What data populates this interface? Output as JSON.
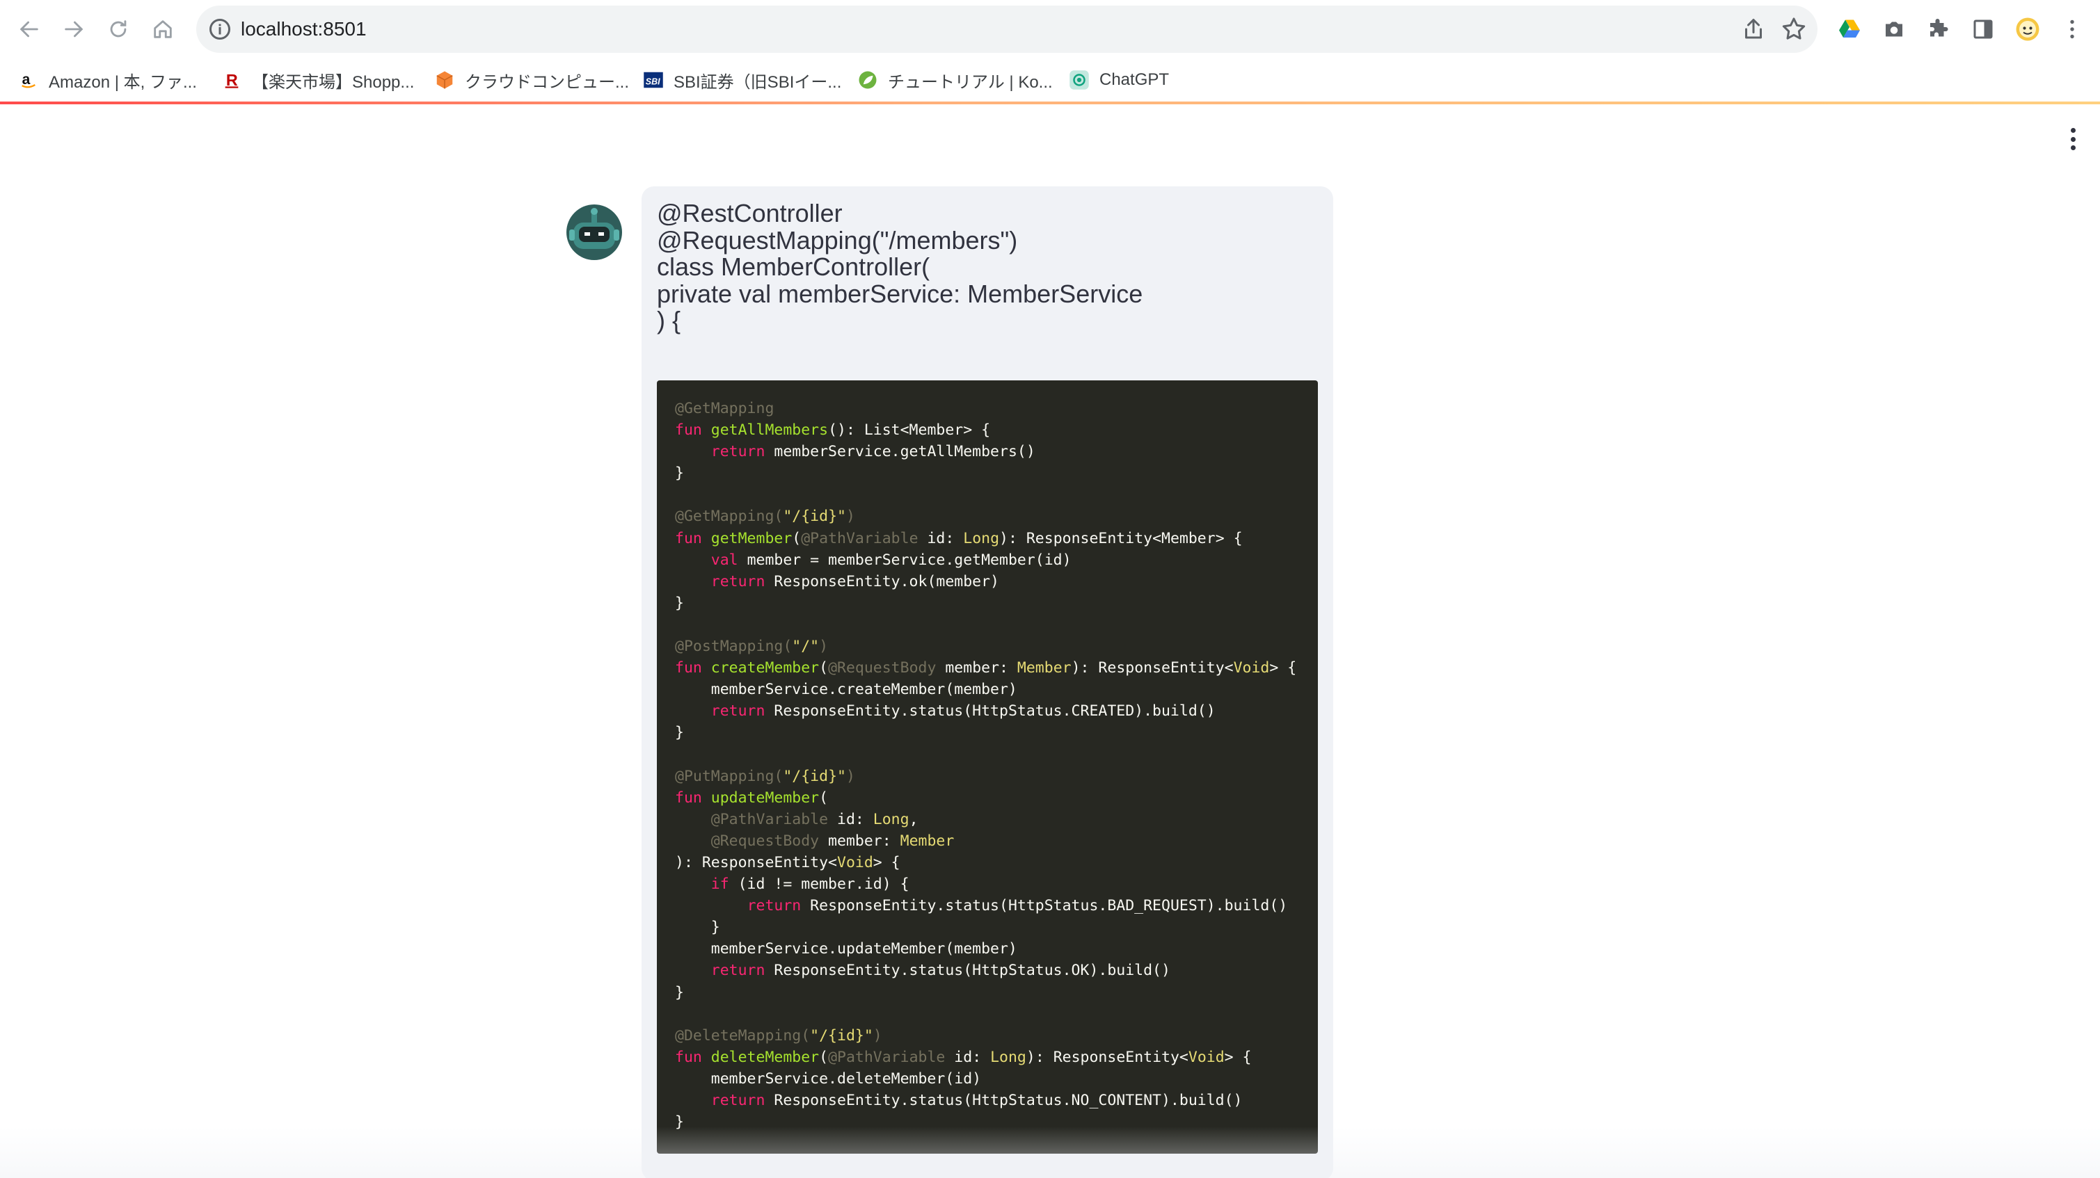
{
  "browser": {
    "url": "localhost:8501",
    "bookmarks": [
      {
        "label": "Amazon | 本, ファ...",
        "icon": "amazon-icon"
      },
      {
        "label": "【楽天市場】Shopp...",
        "icon": "rakuten-icon"
      },
      {
        "label": "クラウドコンピュー...",
        "icon": "cube-icon"
      },
      {
        "label": "SBI証券（旧SBIイー...",
        "icon": "sbi-icon"
      },
      {
        "label": "チュートリアル | Ko...",
        "icon": "leaf-icon"
      },
      {
        "label": "ChatGPT",
        "icon": "chatgpt-icon"
      }
    ]
  },
  "chat": {
    "message_lines": [
      "@RestController",
      "@RequestMapping(\"/members\")",
      "class MemberController(",
      "private val memberService: MemberService",
      ") {"
    ],
    "code_lines": [
      [
        {
          "c": "a",
          "t": "@GetMapping"
        }
      ],
      [
        {
          "c": "k",
          "t": "fun "
        },
        {
          "c": "f",
          "t": "getAllMembers"
        },
        {
          "c": "p",
          "t": "(): List<Member> {"
        }
      ],
      [
        {
          "c": "p",
          "t": "    "
        },
        {
          "c": "k",
          "t": "return"
        },
        {
          "c": "p",
          "t": " memberService.getAllMembers()"
        }
      ],
      [
        {
          "c": "p",
          "t": "}"
        }
      ],
      [
        {
          "c": "p",
          "t": ""
        }
      ],
      [
        {
          "c": "a",
          "t": "@GetMapping("
        },
        {
          "c": "s",
          "t": "\"/{id}\""
        },
        {
          "c": "a",
          "t": ")"
        }
      ],
      [
        {
          "c": "k",
          "t": "fun "
        },
        {
          "c": "f",
          "t": "getMember"
        },
        {
          "c": "p",
          "t": "("
        },
        {
          "c": "a",
          "t": "@PathVariable"
        },
        {
          "c": "p",
          "t": " id: "
        },
        {
          "c": "t",
          "t": "Long"
        },
        {
          "c": "p",
          "t": "): ResponseEntity<Member> {"
        }
      ],
      [
        {
          "c": "p",
          "t": "    "
        },
        {
          "c": "k",
          "t": "val"
        },
        {
          "c": "p",
          "t": " member = memberService.getMember(id)"
        }
      ],
      [
        {
          "c": "p",
          "t": "    "
        },
        {
          "c": "k",
          "t": "return"
        },
        {
          "c": "p",
          "t": " ResponseEntity.ok(member)"
        }
      ],
      [
        {
          "c": "p",
          "t": "}"
        }
      ],
      [
        {
          "c": "p",
          "t": ""
        }
      ],
      [
        {
          "c": "a",
          "t": "@PostMapping("
        },
        {
          "c": "s",
          "t": "\"/\""
        },
        {
          "c": "a",
          "t": ")"
        }
      ],
      [
        {
          "c": "k",
          "t": "fun "
        },
        {
          "c": "f",
          "t": "createMember"
        },
        {
          "c": "p",
          "t": "("
        },
        {
          "c": "a",
          "t": "@RequestBody"
        },
        {
          "c": "p",
          "t": " member: "
        },
        {
          "c": "t",
          "t": "Member"
        },
        {
          "c": "p",
          "t": "): ResponseEntity<"
        },
        {
          "c": "t",
          "t": "Void"
        },
        {
          "c": "p",
          "t": "> {"
        }
      ],
      [
        {
          "c": "p",
          "t": "    memberService.createMember(member)"
        }
      ],
      [
        {
          "c": "p",
          "t": "    "
        },
        {
          "c": "k",
          "t": "return"
        },
        {
          "c": "p",
          "t": " ResponseEntity.status(HttpStatus.CREATED).build()"
        }
      ],
      [
        {
          "c": "p",
          "t": "}"
        }
      ],
      [
        {
          "c": "p",
          "t": ""
        }
      ],
      [
        {
          "c": "a",
          "t": "@PutMapping("
        },
        {
          "c": "s",
          "t": "\"/{id}\""
        },
        {
          "c": "a",
          "t": ")"
        }
      ],
      [
        {
          "c": "k",
          "t": "fun "
        },
        {
          "c": "f",
          "t": "updateMember"
        },
        {
          "c": "p",
          "t": "("
        }
      ],
      [
        {
          "c": "p",
          "t": "    "
        },
        {
          "c": "a",
          "t": "@PathVariable"
        },
        {
          "c": "p",
          "t": " id: "
        },
        {
          "c": "t",
          "t": "Long"
        },
        {
          "c": "p",
          "t": ","
        }
      ],
      [
        {
          "c": "p",
          "t": "    "
        },
        {
          "c": "a",
          "t": "@RequestBody"
        },
        {
          "c": "p",
          "t": " member: "
        },
        {
          "c": "t",
          "t": "Member"
        }
      ],
      [
        {
          "c": "p",
          "t": "): ResponseEntity<"
        },
        {
          "c": "t",
          "t": "Void"
        },
        {
          "c": "p",
          "t": "> {"
        }
      ],
      [
        {
          "c": "p",
          "t": "    "
        },
        {
          "c": "k",
          "t": "if"
        },
        {
          "c": "p",
          "t": " (id != member.id) {"
        }
      ],
      [
        {
          "c": "p",
          "t": "        "
        },
        {
          "c": "k",
          "t": "return"
        },
        {
          "c": "p",
          "t": " ResponseEntity.status(HttpStatus.BAD_REQUEST).build()"
        }
      ],
      [
        {
          "c": "p",
          "t": "    }"
        }
      ],
      [
        {
          "c": "p",
          "t": "    memberService.updateMember(member)"
        }
      ],
      [
        {
          "c": "p",
          "t": "    "
        },
        {
          "c": "k",
          "t": "return"
        },
        {
          "c": "p",
          "t": " ResponseEntity.status(HttpStatus.OK).build()"
        }
      ],
      [
        {
          "c": "p",
          "t": "}"
        }
      ],
      [
        {
          "c": "p",
          "t": ""
        }
      ],
      [
        {
          "c": "a",
          "t": "@DeleteMapping("
        },
        {
          "c": "s",
          "t": "\"/{id}\""
        },
        {
          "c": "a",
          "t": ")"
        }
      ],
      [
        {
          "c": "k",
          "t": "fun "
        },
        {
          "c": "f",
          "t": "deleteMember"
        },
        {
          "c": "p",
          "t": "("
        },
        {
          "c": "a",
          "t": "@PathVariable"
        },
        {
          "c": "p",
          "t": " id: "
        },
        {
          "c": "t",
          "t": "Long"
        },
        {
          "c": "p",
          "t": "): ResponseEntity<"
        },
        {
          "c": "t",
          "t": "Void"
        },
        {
          "c": "p",
          "t": "> {"
        }
      ],
      [
        {
          "c": "p",
          "t": "    memberService.deleteMember(id)"
        }
      ],
      [
        {
          "c": "p",
          "t": "    "
        },
        {
          "c": "k",
          "t": "return"
        },
        {
          "c": "p",
          "t": " ResponseEntity.status(HttpStatus.NO_CONTENT).build()"
        }
      ],
      [
        {
          "c": "p",
          "t": "}"
        }
      ]
    ]
  },
  "colors": {
    "code_background": "#272822",
    "message_background": "#f0f2f6",
    "keyword": "#f92672",
    "function": "#a6e22e",
    "annotation": "#75715e",
    "string": "#e6db74"
  }
}
